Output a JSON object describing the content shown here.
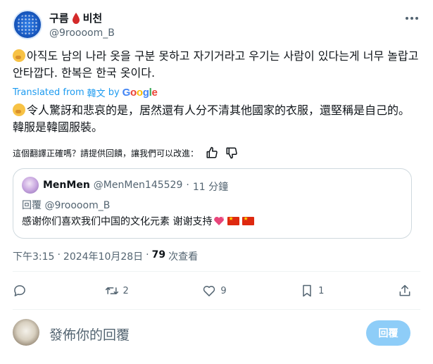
{
  "author": {
    "name_prefix": "구름",
    "name_suffix": "비천",
    "handle": "@9roooom_B"
  },
  "post": {
    "korean_text": "아직도 남의 나라 옷을 구분 못하고 자기거라고 우기는 사람이 있다는게 너무 놀랍고 안타깝다. 한복은 한국 옷이다.",
    "translated_label": "Translated from",
    "translated_lang": "韓文",
    "translated_by": "by",
    "google_letters": [
      "G",
      "o",
      "o",
      "g",
      "l",
      "e"
    ],
    "google_colors": [
      "#4285f4",
      "#ea4335",
      "#fbbc05",
      "#4285f4",
      "#34a853",
      "#ea4335"
    ],
    "translated_text": "令人驚訝和悲哀的是，居然還有人分不清其他國家的衣服，還堅稱是自己的。韓服是韓國服裝。"
  },
  "feedback": {
    "question": "這個翻譯正確嗎？請提供回饋，讓我們可以改進："
  },
  "quote": {
    "name": "MenMen",
    "handle": "@MenMen145529",
    "separator": "·",
    "time": "11 分鐘",
    "replying_to": "回覆 @9roooom_B",
    "text": "感谢你们喜欢我们中国的文化元素 谢谢支持"
  },
  "meta": {
    "time": "下午3:15",
    "separator": "·",
    "date": "2024年10月28日",
    "views_count": "79",
    "views_label": "次查看"
  },
  "actions": {
    "reply_count": "",
    "retweet_count": "2",
    "like_count": "9",
    "bookmark_count": "1"
  },
  "reply_box": {
    "placeholder": "發佈你的回覆",
    "button_label": "回覆"
  },
  "colors": {
    "accent": "#1d9bf0",
    "reply_button_disabled": "#8ecdf8",
    "secondary_text": "#536471",
    "border": "#cfd9de"
  },
  "icons": [
    "more-icon",
    "blood-drop-icon",
    "thinking-emoji-icon",
    "thumbs-up-icon",
    "thumbs-down-icon",
    "reply-icon",
    "retweet-icon",
    "like-icon",
    "bookmark-icon",
    "share-icon",
    "sparkling-heart-icon",
    "china-flag-icon"
  ]
}
